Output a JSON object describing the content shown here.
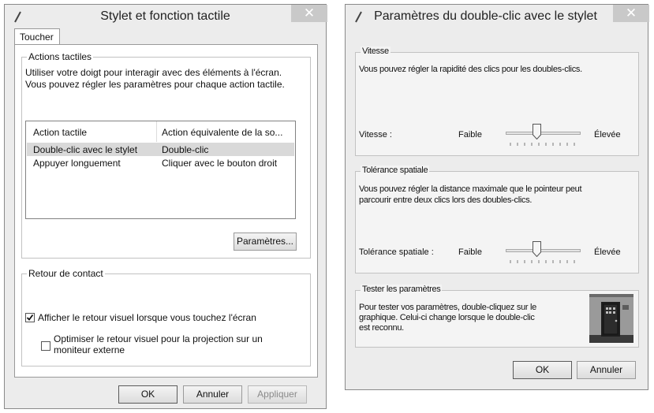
{
  "left_dialog": {
    "title": "Stylet et fonction tactile",
    "tab": "Toucher",
    "actions_group": {
      "label": "Actions tactiles",
      "description_line1": "Utiliser votre doigt pour interagir avec des éléments à l'écran.",
      "description_line2": "Vous pouvez régler les paramètres pour chaque action tactile.",
      "columns": [
        "Action tactile",
        "Action équivalente de la so..."
      ],
      "rows": [
        {
          "action": "Double-clic avec le stylet",
          "equivalent": "Double-clic",
          "selected": true
        },
        {
          "action": "Appuyer longuement",
          "equivalent": "Cliquer avec le bouton droit",
          "selected": false
        }
      ],
      "settings_button": "Paramètres..."
    },
    "feedback_group": {
      "label": "Retour de contact",
      "checkbox1": "Afficher le retour visuel lorsque vous touchez l'écran",
      "checkbox1_checked": true,
      "checkbox2_line1": "Optimiser le retour visuel pour la projection sur un",
      "checkbox2_line2": "moniteur externe",
      "checkbox2_checked": false
    },
    "ok": "OK",
    "cancel": "Annuler",
    "apply": "Appliquer"
  },
  "right_dialog": {
    "title": "Paramètres du double-clic avec le stylet",
    "speed_group": {
      "label": "Vitesse",
      "description": "Vous pouvez régler la rapidité des clics pour les doubles-clics.",
      "slider_label": "Vitesse :",
      "low": "Faible",
      "high": "Élevée",
      "value_fraction": 0.4
    },
    "tolerance_group": {
      "label": "Tolérance spatiale",
      "description_line1": "Vous pouvez régler la distance maximale que le pointeur peut",
      "description_line2": "parcourir entre deux clics lors des doubles-clics.",
      "slider_label": "Tolérance spatiale :",
      "low": "Faible",
      "high": "Élevée",
      "value_fraction": 0.4
    },
    "test_group": {
      "label": "Tester les paramètres",
      "description_line1": "Pour tester vos paramètres, double-cliquez sur le",
      "description_line2": "graphique. Celui-ci change lorsque le double-clic",
      "description_line3": "est reconnu."
    },
    "ok": "OK",
    "cancel": "Annuler"
  }
}
